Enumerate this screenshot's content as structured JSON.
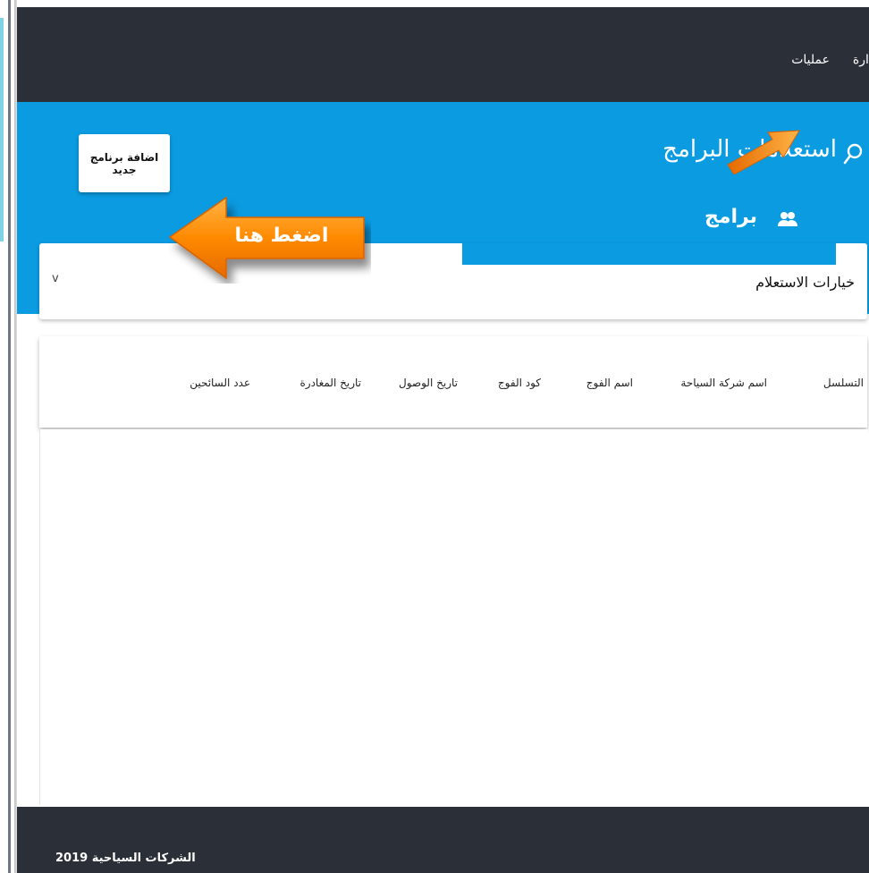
{
  "nav": {
    "operations_label": "عمليات",
    "admin_label": "إدارة"
  },
  "hero": {
    "heading": "استعلامات البرامج",
    "add_button_label": "اضافة برنامج جديد",
    "section_title": "برامج"
  },
  "query": {
    "label": "خيارات الاستعلام",
    "chevron": "v"
  },
  "table": {
    "columns": [
      "التسلسل",
      "اسم شركة السياحة",
      "اسم الفوج",
      "كود الفوج",
      "تاريخ الوصول",
      "تاريخ المغادرة",
      "عدد السائحين"
    ]
  },
  "footer": {
    "text": "الشركات السياحية 2019"
  },
  "tutorial": {
    "callout_text": "اضغط هنا"
  },
  "colors": {
    "topbar": "#2a2f38",
    "hero": "#0b9be1",
    "arrow": "#ff8a00"
  },
  "icons": {
    "search": "search-icon",
    "group": "group-icon",
    "chevron": "chevron-down-icon"
  }
}
